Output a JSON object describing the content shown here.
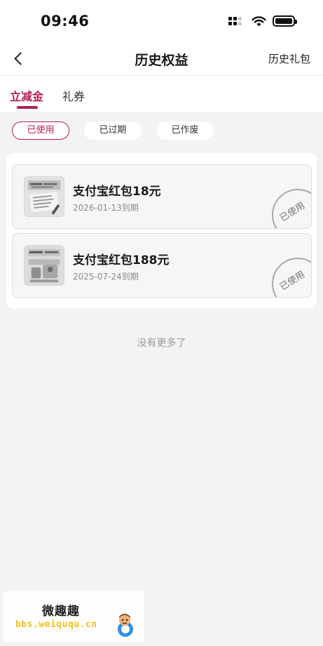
{
  "status_bar": {
    "time": "09:46"
  },
  "nav": {
    "title": "历史权益",
    "right_label": "历史礼包"
  },
  "tabs": [
    {
      "label": "立减金",
      "active": true
    },
    {
      "label": "礼券",
      "active": false
    }
  ],
  "filters": [
    {
      "label": "已使用",
      "active": true
    },
    {
      "label": "已过期",
      "active": false
    },
    {
      "label": "已作废",
      "active": false
    }
  ],
  "coupons": [
    {
      "title": "支付宝红包18元",
      "expiry": "2026-01-13到期",
      "stamp": "已使用",
      "thumb_icon": "newspaper-promo-icon"
    },
    {
      "title": "支付宝红包188元",
      "expiry": "2025-07-24到期",
      "stamp": "已使用",
      "thumb_icon": "red-packet-promo-icon"
    }
  ],
  "footer_text": "没有更多了",
  "watermark": {
    "cn": "微趣趣",
    "url": "bbs.weiququ.cn"
  },
  "colors": {
    "accent": "#b3234f",
    "background": "#f3f3f3",
    "card": "#ffffff"
  }
}
